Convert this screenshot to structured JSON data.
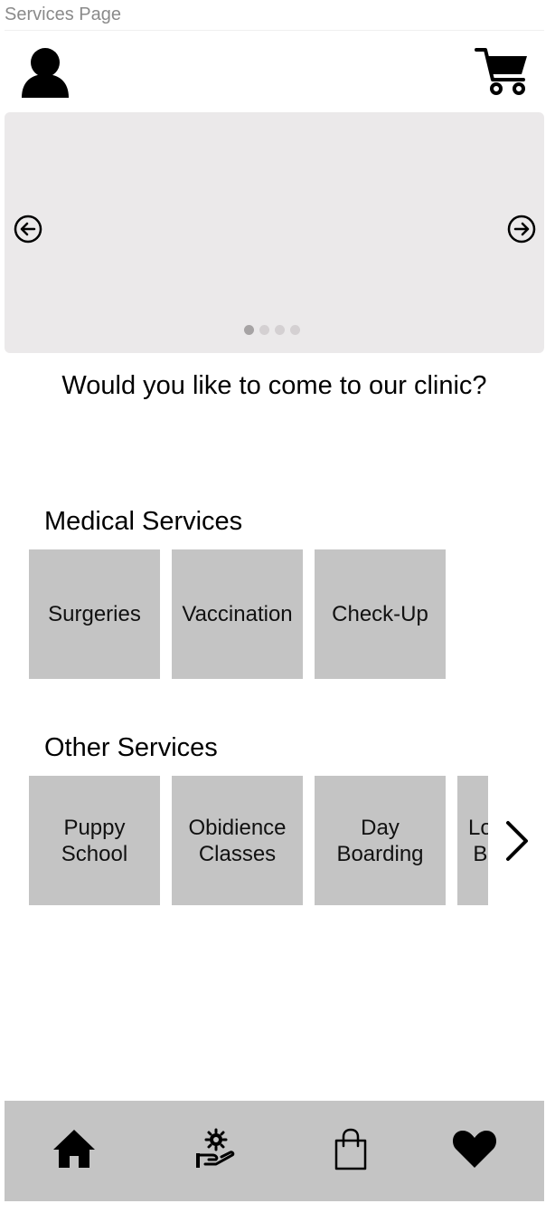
{
  "frame": {
    "label": "Services Page"
  },
  "header": {
    "profile_icon": "user-icon",
    "cart_icon": "cart-icon"
  },
  "carousel": {
    "prev_icon": "arrow-left-circle-icon",
    "next_icon": "arrow-right-circle-icon",
    "slide_count": 4,
    "active_slide": 1
  },
  "main": {
    "question": "Would you like to come to our clinic?",
    "medical": {
      "title": "Medical Services",
      "items": [
        "Surgeries",
        "Vaccination",
        "Check-Up"
      ]
    },
    "other": {
      "title": "Other Services",
      "items": [
        "Puppy\nSchool",
        "Obidience\nClasses",
        "Day\nBoarding",
        "Lo\nB"
      ],
      "more_icon": "chevron-right-icon"
    }
  },
  "bottom_nav": {
    "items": [
      "home-icon",
      "pet-care-icon",
      "shopping-bag-icon",
      "heart-icon"
    ]
  },
  "colors": {
    "carousel_bg": "#ebe9ea",
    "tile_bg": "#c4c4c4",
    "nav_bg": "#c4c4c4",
    "frame_label": "#8a8a8a"
  }
}
